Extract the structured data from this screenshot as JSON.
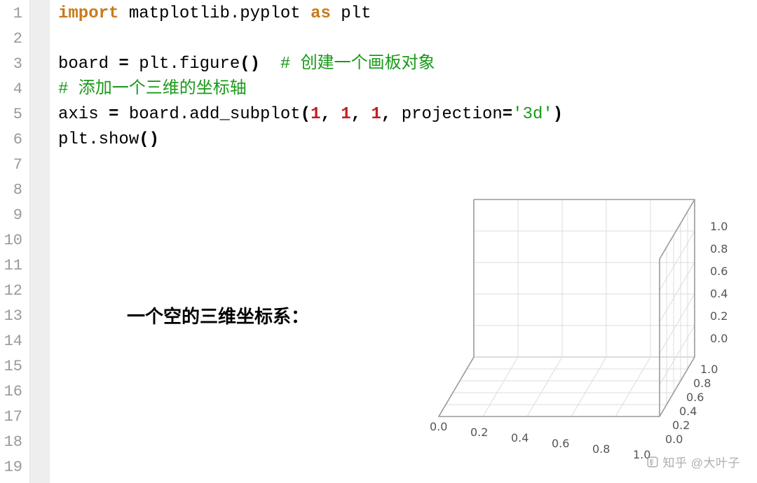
{
  "gutter": {
    "lines": [
      "1",
      "2",
      "3",
      "4",
      "5",
      "6",
      "7",
      "8",
      "9",
      "10",
      "11",
      "12",
      "13",
      "14",
      "15",
      "16",
      "17",
      "18",
      "19"
    ]
  },
  "code": {
    "l1_import": "import",
    "l1_mod": " matplotlib.pyplot ",
    "l1_as": "as",
    "l1_alias": " plt",
    "l3_lhs": "board ",
    "l3_eq": "=",
    "l3_rhs": " plt.figure",
    "l3_open": "(",
    "l3_close": ")",
    "l3_cmt": "  # 创建一个画板对象",
    "l4_cmt": "# 添加一个三维的坐标轴",
    "l5_lhs": "axis ",
    "l5_eq": "=",
    "l5_rhs": " board.add_subplot",
    "l5_open": "(",
    "l5_n1": "1",
    "l5_c1": ", ",
    "l5_n2": "1",
    "l5_c2": ", ",
    "l5_n3": "1",
    "l5_c3": ", ",
    "l5_kw": "projection",
    "l5_eq2": "=",
    "l5_str": "'3d'",
    "l5_close": ")",
    "l6_call": "plt.show",
    "l6_open": "(",
    "l6_close": ")"
  },
  "caption": "一个空的三维坐标系：",
  "chart_data": {
    "type": "3d-axes",
    "title": "",
    "series": [],
    "x_ticks": [
      "0.0",
      "0.2",
      "0.4",
      "0.6",
      "0.8",
      "1.0"
    ],
    "y_ticks": [
      "0.0",
      "0.2",
      "0.4",
      "0.6",
      "0.8",
      "1.0"
    ],
    "z_ticks": [
      "0.0",
      "0.2",
      "0.4",
      "0.6",
      "0.8",
      "1.0"
    ],
    "xlim": [
      0.0,
      1.0
    ],
    "ylim": [
      0.0,
      1.0
    ],
    "zlim": [
      0.0,
      1.0
    ]
  },
  "watermark": "知乎 @大叶子"
}
